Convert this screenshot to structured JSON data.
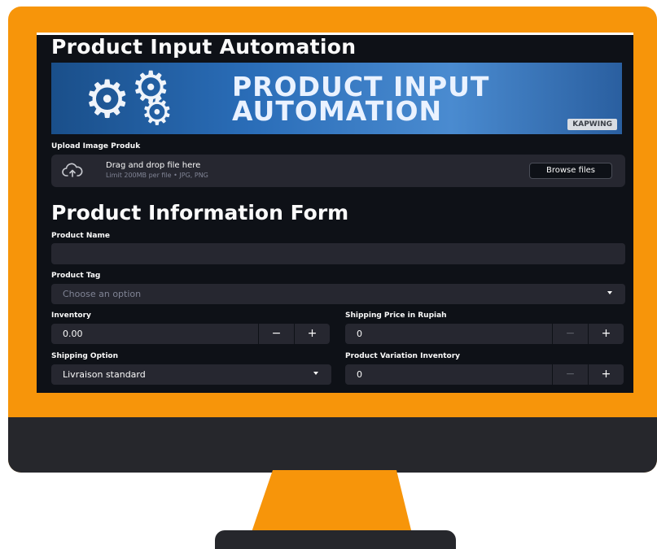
{
  "app": {
    "title": "Product Input Automation"
  },
  "banner": {
    "line1": "PRODUCT INPUT",
    "line2": "AUTOMATION",
    "watermark": "KAPWING"
  },
  "upload": {
    "label": "Upload Image Produk",
    "drop_title": "Drag and drop file here",
    "drop_limit": "Limit 200MB per file • JPG, PNG",
    "browse_label": "Browse files"
  },
  "form": {
    "title": "Product Information Form",
    "product_name": {
      "label": "Product Name",
      "value": ""
    },
    "product_tag": {
      "label": "Product Tag",
      "placeholder": "Choose an option"
    },
    "inventory": {
      "label": "Inventory",
      "value": "0.00",
      "minus": "−",
      "plus": "+"
    },
    "shipping_price": {
      "label": "Shipping Price in Rupiah",
      "value": "0",
      "minus": "−",
      "plus": "+"
    },
    "shipping_option": {
      "label": "Shipping Option",
      "value": "Livraison standard"
    },
    "variation_inventory": {
      "label": "Product Variation Inventory",
      "value": "0",
      "minus": "−",
      "plus": "+"
    }
  },
  "colors": {
    "frame": "#f7950a",
    "bezel": "#26272c",
    "screen_bg": "#0e1117",
    "widget_bg": "#262730",
    "text": "#fafafa",
    "muted": "#808495"
  },
  "icons": {
    "upload": "cloud-upload-icon",
    "dropdown": "chevron-down-icon",
    "gear": "gear-icon"
  }
}
